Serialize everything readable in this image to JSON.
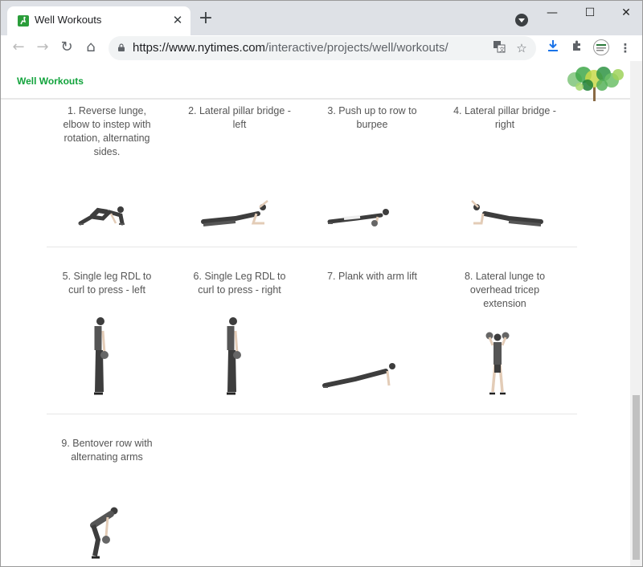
{
  "browser": {
    "tab_title": "Well Workouts",
    "tab_close": "✕",
    "new_tab": "+",
    "url_host": "https://www.nytimes.com",
    "url_path": "/interactive/projects/well/workouts/",
    "window_controls": {
      "minimize": "—",
      "maximize": "☐",
      "close": "✕"
    },
    "nav": {
      "back": "←",
      "forward": "→",
      "reload": "↻",
      "home": "⌂"
    },
    "icons": [
      "translate-icon",
      "star-icon",
      "download-icon",
      "extensions-icon",
      "profile-icon",
      "menu-icon"
    ]
  },
  "site": {
    "title": "Well Workouts"
  },
  "exercises": [
    {
      "label": "1. Reverse lunge, elbow to instep with rotation, alternating sides."
    },
    {
      "label": "2. Lateral pillar bridge - left"
    },
    {
      "label": "3. Push up to row to burpee"
    },
    {
      "label": "4. Lateral pillar bridge - right"
    },
    {
      "label": "5. Single leg RDL to curl to press - left"
    },
    {
      "label": "6. Single Leg RDL to curl to press - right"
    },
    {
      "label": "7. Plank with arm lift"
    },
    {
      "label": "8. Lateral lunge to overhead tricep extension"
    },
    {
      "label": "9. Bentover row with alternating arms"
    }
  ],
  "colors": {
    "brand_green": "#12a33c",
    "figure_dark": "#3d3d3d",
    "figure_light": "#bdbdbd",
    "skin": "#e3ccb7"
  }
}
